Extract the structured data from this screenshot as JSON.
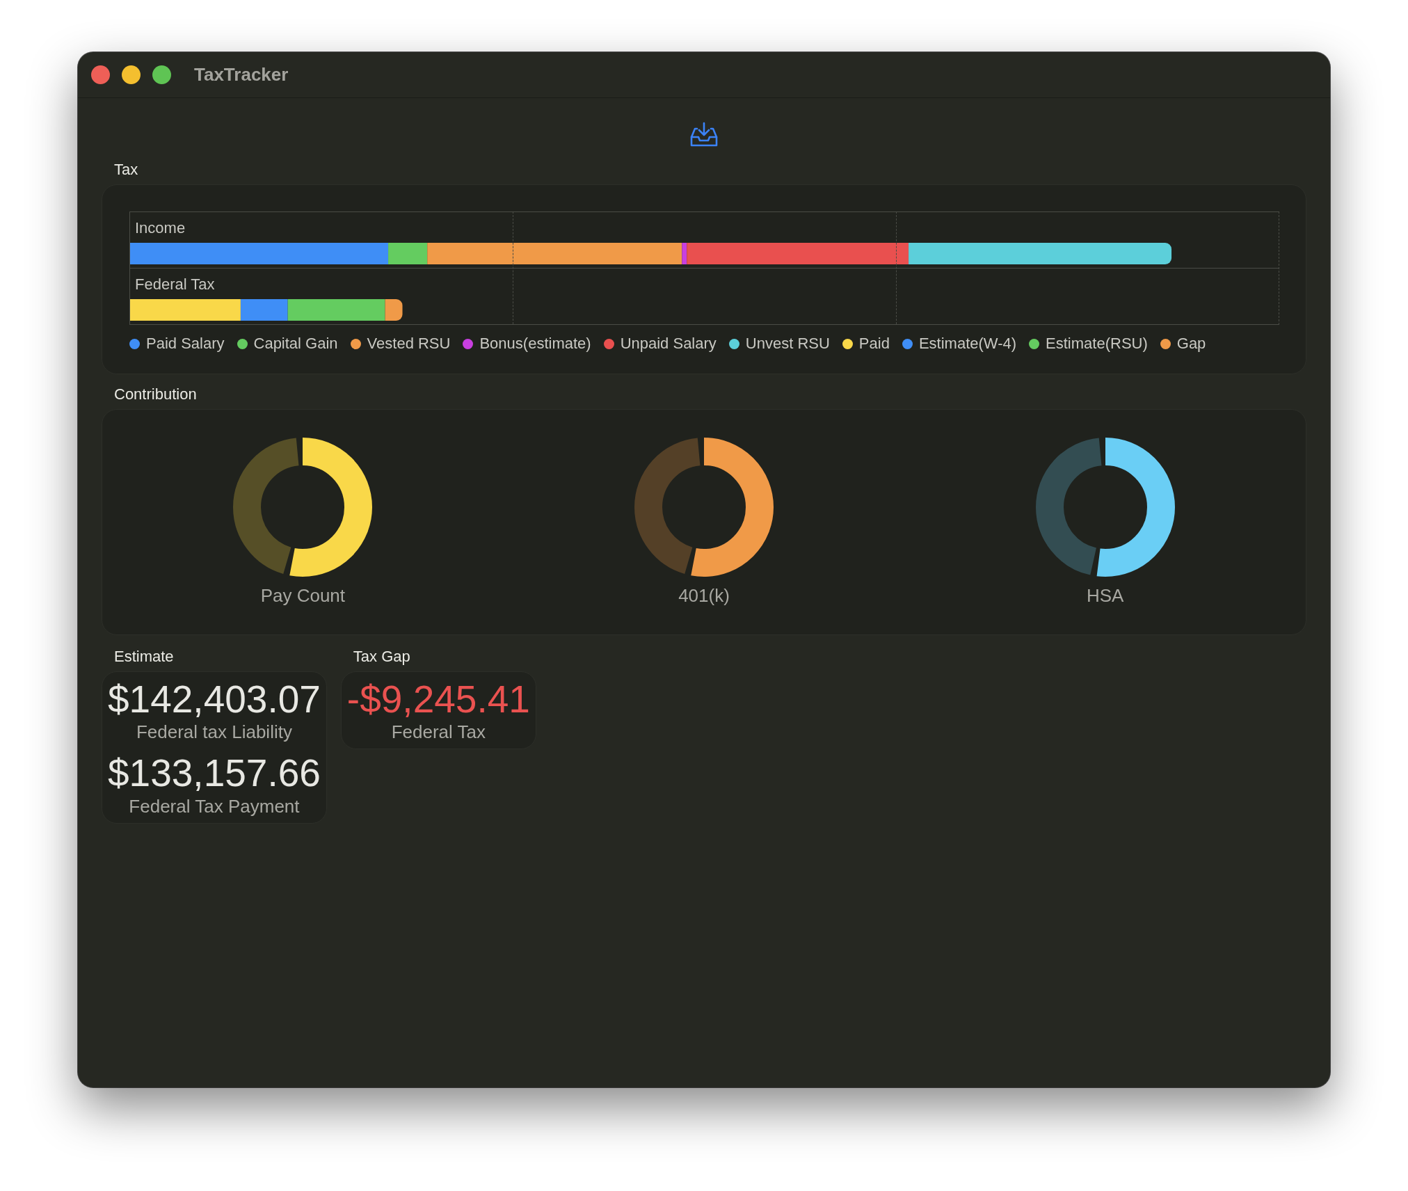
{
  "window": {
    "title": "TaxTracker"
  },
  "tax": {
    "title": "Tax",
    "rows": [
      {
        "label": "Income"
      },
      {
        "label": "Federal Tax"
      }
    ],
    "legend": [
      {
        "label": "Paid Salary",
        "color": "#3f8ef6"
      },
      {
        "label": "Capital Gain",
        "color": "#64cc60"
      },
      {
        "label": "Vested RSU",
        "color": "#f09a48"
      },
      {
        "label": "Bonus(estimate)",
        "color": "#c83fe0"
      },
      {
        "label": "Unpaid Salary",
        "color": "#e9504f"
      },
      {
        "label": "Unvest RSU",
        "color": "#5ccfda"
      },
      {
        "label": "Paid",
        "color": "#f9d849"
      },
      {
        "label": "Estimate(W-4)",
        "color": "#3f8ef6"
      },
      {
        "label": "Estimate(RSU)",
        "color": "#64cc60"
      },
      {
        "label": "Gap",
        "color": "#f09a48"
      }
    ]
  },
  "contribution": {
    "title": "Contribution",
    "rings": [
      {
        "label": "Pay Count",
        "level": 0.53,
        "color": "#f9d849"
      },
      {
        "label": "401(k)",
        "level": 0.53,
        "color": "#f09a48"
      },
      {
        "label": "HSA",
        "level": 0.52,
        "color": "#6acef5"
      }
    ]
  },
  "estimate": {
    "title": "Estimate",
    "items": [
      {
        "value": "$142,403.07",
        "caption": "Federal tax Liability",
        "negative": false
      },
      {
        "value": "$133,157.66",
        "caption": "Federal Tax Payment",
        "negative": false
      }
    ]
  },
  "tax_gap": {
    "title": "Tax Gap",
    "items": [
      {
        "value": "-$9,245.41",
        "caption": "Federal Tax",
        "negative": true
      }
    ]
  }
}
